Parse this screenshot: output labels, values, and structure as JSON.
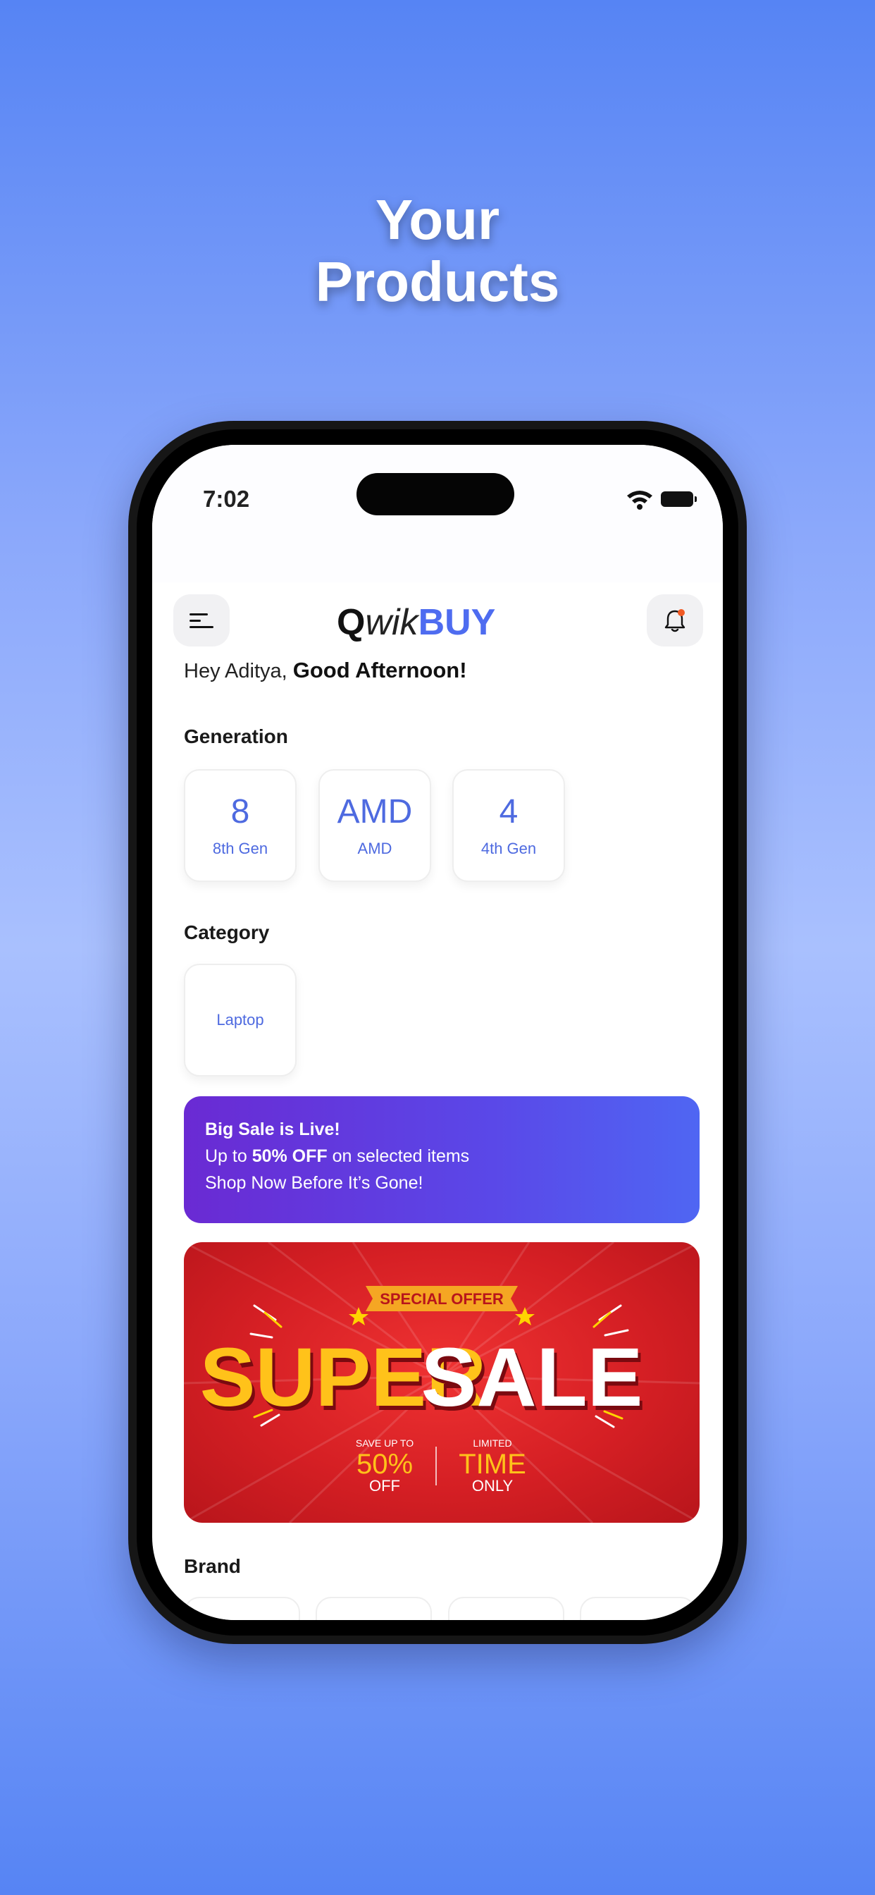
{
  "headline": {
    "line1": "Your",
    "line2": "Products"
  },
  "status_bar": {
    "time": "7:02"
  },
  "header": {
    "logo": {
      "q": "Q",
      "wik": "wik",
      "buy": "BUY"
    }
  },
  "greeting": {
    "prefix": "Hey Aditya,",
    "emphasis": "Good Afternoon!"
  },
  "generation": {
    "title": "Generation",
    "items": [
      {
        "value": "8",
        "label": "8th Gen"
      },
      {
        "value": "AMD",
        "label": "AMD"
      },
      {
        "value": "4",
        "label": "4th Gen"
      }
    ]
  },
  "category": {
    "title": "Category",
    "items": [
      {
        "label": "Laptop"
      }
    ]
  },
  "promo": {
    "line1": "Big Sale is Live!",
    "line2_prefix": "Up to ",
    "line2_bold": "50% OFF",
    "line2_suffix": " on selected items",
    "line3": "Shop Now Before It’s Gone!"
  },
  "banner": {
    "ribbon": "SPECIAL OFFER",
    "word1": "SUPER",
    "word2": "SALE",
    "save_up_to": "SAVE UP TO",
    "percent": "50%",
    "off": "OFF",
    "limited": "LIMITED",
    "time": "TIME",
    "only": "ONLY"
  },
  "brand": {
    "title": "Brand"
  },
  "icons": {
    "menu": "menu-icon",
    "bell": "bell-icon",
    "wifi": "wifi-icon",
    "battery": "battery-icon"
  },
  "colors": {
    "accent": "#4e6cf0",
    "promo_start": "#6a2ad3",
    "promo_end": "#4f66f3",
    "banner_red": "#d51f24",
    "notification_dot": "#f15a24"
  }
}
